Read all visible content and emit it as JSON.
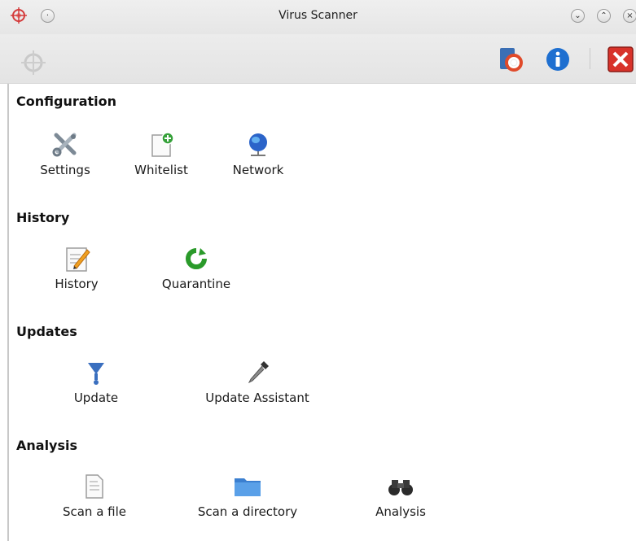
{
  "window": {
    "title": "Virus Scanner"
  },
  "sections": [
    {
      "title": "Configuration",
      "items": [
        {
          "label": "Settings",
          "icon": "settings-icon"
        },
        {
          "label": "Whitelist",
          "icon": "whitelist-icon"
        },
        {
          "label": "Network",
          "icon": "network-icon"
        }
      ]
    },
    {
      "title": "History",
      "items": [
        {
          "label": "History",
          "icon": "history-icon"
        },
        {
          "label": "Quarantine",
          "icon": "quarantine-icon"
        }
      ]
    },
    {
      "title": "Updates",
      "items": [
        {
          "label": "Update",
          "icon": "update-icon"
        },
        {
          "label": "Update Assistant",
          "icon": "update-assistant-icon"
        }
      ]
    },
    {
      "title": "Analysis",
      "items": [
        {
          "label": "Scan a file",
          "icon": "scan-file-icon"
        },
        {
          "label": "Scan a directory",
          "icon": "scan-directory-icon"
        },
        {
          "label": "Analysis",
          "icon": "analysis-icon"
        }
      ]
    }
  ],
  "colors": {
    "titlebar": "#e8e8e8",
    "toolbar": "#e6e6e6",
    "info_blue": "#1e6fd0",
    "close_red": "#d8322a"
  }
}
